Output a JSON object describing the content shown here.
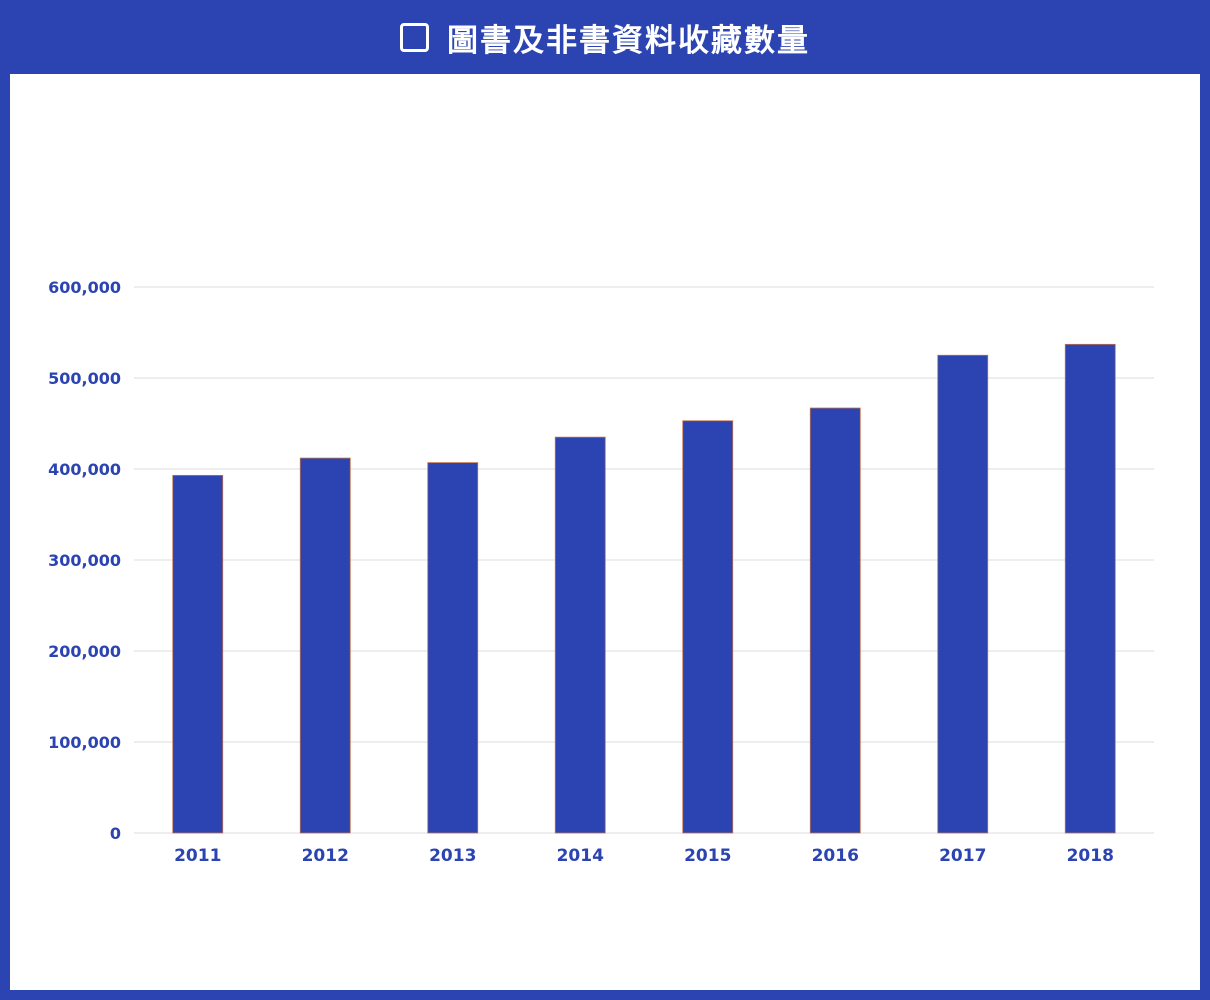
{
  "header": {
    "title": "圖書及非書資料收藏數量",
    "icon": "square-outline-icon"
  },
  "colors": {
    "background": "#2b44b1",
    "bar": "#2b44b1",
    "bar_outline": "#c0704a",
    "grid": "#dddddd",
    "tick_text": "#2b44b1"
  },
  "chart_data": {
    "type": "bar",
    "title": "圖書及非書資料收藏數量",
    "xlabel": "",
    "ylabel": "",
    "categories": [
      "2011",
      "2012",
      "2013",
      "2014",
      "2015",
      "2016",
      "2017",
      "2018"
    ],
    "values": [
      393000,
      412000,
      407000,
      435000,
      453000,
      467000,
      525000,
      537000
    ],
    "ylim": [
      0,
      600000
    ],
    "yticks": [
      0,
      100000,
      200000,
      300000,
      400000,
      500000,
      600000
    ],
    "ytick_labels": [
      "0",
      "100,000",
      "200,000",
      "300,000",
      "400,000",
      "500,000",
      "600,000"
    ],
    "grid": true,
    "legend": "none"
  }
}
